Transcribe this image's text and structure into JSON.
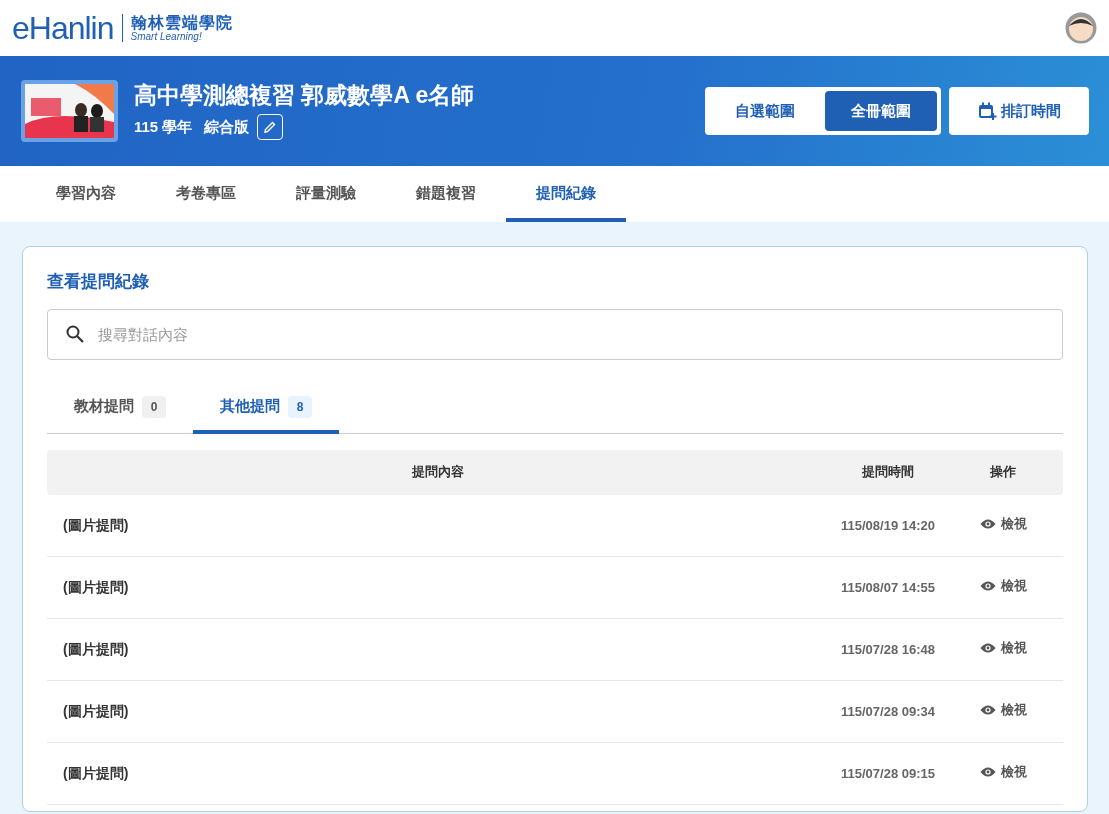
{
  "logo": {
    "brand": "eHanlin",
    "name": "翰林雲端學院",
    "slogan": "Smart Learning!"
  },
  "course": {
    "title": "高中學測總複習 郭威數學A e名師",
    "year": "115 學年",
    "edition": "綜合版"
  },
  "scope_options": [
    {
      "label": "自選範圍",
      "selected": false
    },
    {
      "label": "全冊範圍",
      "selected": true
    }
  ],
  "schedule_button": "排訂時間",
  "tabs": [
    {
      "label": "學習內容",
      "selected": false
    },
    {
      "label": "考卷專區",
      "selected": false
    },
    {
      "label": "評量測驗",
      "selected": false
    },
    {
      "label": "錯題複習",
      "selected": false
    },
    {
      "label": "提問紀錄",
      "selected": true
    }
  ],
  "panel": {
    "title": "查看提問紀錄",
    "search": {
      "placeholder": "搜尋對話內容"
    },
    "subtabs": [
      {
        "label": "教材提問",
        "count": "0",
        "selected": false
      },
      {
        "label": "其他提問",
        "count": "8",
        "selected": true
      }
    ],
    "table": {
      "columns": [
        "提問內容",
        "提問時間",
        "操作"
      ],
      "rows": [
        {
          "content": "(圖片提問)",
          "time": "115/08/19 14:20",
          "action": "檢視"
        },
        {
          "content": "(圖片提問)",
          "time": "115/08/07 14:55",
          "action": "檢視"
        },
        {
          "content": "(圖片提問)",
          "time": "115/07/28 16:48",
          "action": "檢視"
        },
        {
          "content": "(圖片提問)",
          "time": "115/07/28 09:34",
          "action": "檢視"
        },
        {
          "content": "(圖片提問)",
          "time": "115/07/28 09:15",
          "action": "檢視"
        }
      ]
    }
  }
}
